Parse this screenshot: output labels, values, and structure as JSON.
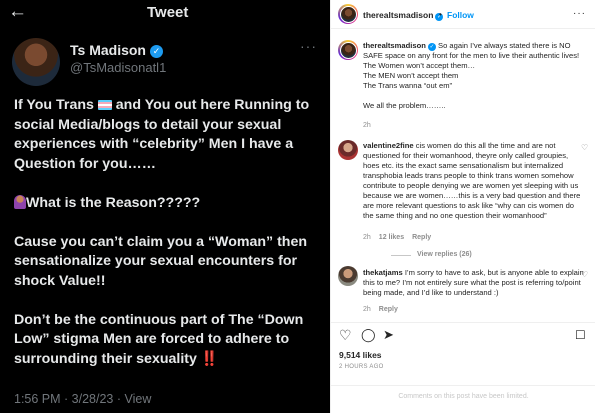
{
  "tweet": {
    "back_icon": "arrow-left-icon",
    "title": "Tweet",
    "author_name": "Ts Madison",
    "author_handle": "@TsMadisonatl1",
    "more_icon": "ellipsis-icon",
    "line1": "If You Trans",
    "line1b": "and You out here Running to social Media/blogs to detail your sexual experiences with “celebrity” Men I have a Question for you……",
    "line2": "What is the Reason?????",
    "line3": "Cause you can’t claim you a “Woman” then sensationalize your sexual encounters for shock Value!!",
    "line4": "Don’t be the continuous part of The “Down Low” stigma Men are forced to adhere to surrounding their sexuality",
    "line4_emoji": "‼️",
    "footer": "1:56 PM · 3/28/23 · View"
  },
  "instagram": {
    "header": {
      "username": "therealtsmadison",
      "separator": "•",
      "follow_label": "Follow",
      "more_icon": "ellipsis-icon"
    },
    "caption": {
      "username": "therealtsmadison",
      "text": "So again I’ve always stated there is NO SAFE space on any front for the men to live their authentic lives!",
      "l2": "The Women won’t accept them…",
      "l3": "The MEN won’t accept them",
      "l4": "The Trans wanna “out em”",
      "l5": "We all the problem……..",
      "time": "2h"
    },
    "comment1": {
      "username": "valentine2fine",
      "text": "cis women do this all the time and are not questioned for their womanhood, theyre only called groupies, hoes etc. its the exact same sensationalism but internalized transphobia leads trans people to think trans women somehow contribute to people denying we are women yet sleeping with us because we are women……this is a very bad question and there are more relevant questions to ask like “why can cis women do the same thing and no one question their womanhood”",
      "time": "2h",
      "likes": "12 likes",
      "reply": "Reply",
      "view_replies": "View replies (26)"
    },
    "comment2": {
      "username": "thekatjams",
      "text": "I’m sorry to have to ask, but is anyone able to explain this to me? I’m not entirely sure what the post is referring to/point being made, and I’d like to understand :)",
      "time": "2h",
      "reply": "Reply"
    },
    "actions": {
      "like_icon": "heart-icon",
      "comment_icon": "comment-icon",
      "share_icon": "paper-plane-icon",
      "save_icon": "bookmark-icon"
    },
    "likes": "9,514 likes",
    "posted": "2 HOURS AGO",
    "comments_limited": "Comments on this post have been limited."
  },
  "colors": {
    "tweet_bg": "#000000",
    "verified_blue": "#1d9bf0",
    "ig_link": "#0095f6"
  }
}
